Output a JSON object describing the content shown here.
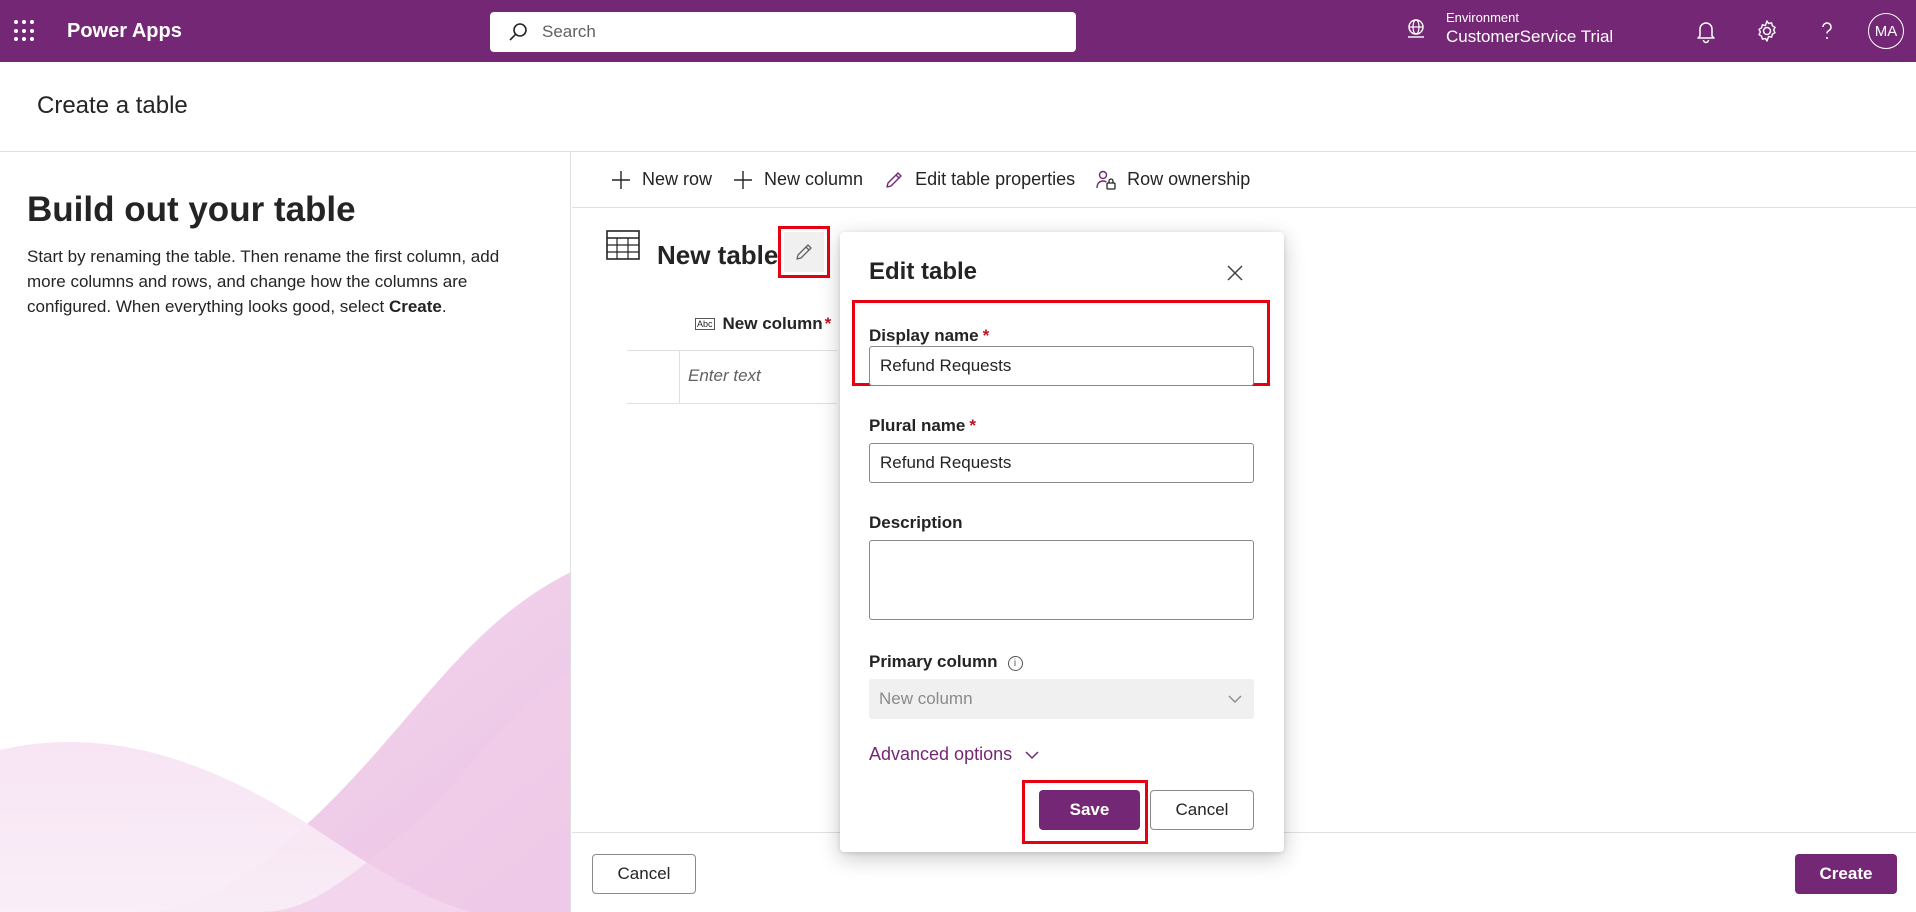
{
  "topbar": {
    "app_name": "Power Apps",
    "search_placeholder": "Search",
    "environment_label": "Environment",
    "environment_name": "CustomerService Trial",
    "avatar_initials": "MA",
    "icons": [
      "waffle-icon",
      "search-icon",
      "environment-icon",
      "bell-icon",
      "gear-icon",
      "help-icon"
    ]
  },
  "page": {
    "title": "Create a table"
  },
  "left_panel": {
    "heading": "Build out your table",
    "description_main": "Start by renaming the table. Then rename the first column, add more columns and rows, and change how the columns are configured. When everything looks good, select ",
    "description_bold": "Create",
    "description_end": "."
  },
  "command_bar": {
    "items": [
      {
        "label": "New row",
        "icon": "plus-icon"
      },
      {
        "label": "New column",
        "icon": "plus-icon"
      },
      {
        "label": "Edit table properties",
        "icon": "pencil-icon"
      },
      {
        "label": "Row ownership",
        "icon": "person-lock-icon"
      }
    ]
  },
  "table": {
    "name": "New table",
    "column_header": "New column",
    "column_required": "*",
    "column_type_icon": "Abc",
    "cell_placeholder": "Enter text"
  },
  "dialog": {
    "title": "Edit table",
    "display_name_label": "Display name",
    "display_name_value": "Refund Requests",
    "plural_name_label": "Plural name",
    "plural_name_value": "Refund Requests",
    "description_label": "Description",
    "description_value": "",
    "primary_column_label": "Primary column",
    "primary_column_value": "New column",
    "advanced_options": "Advanced options",
    "required_mark": "*",
    "save_label": "Save",
    "cancel_label": "Cancel"
  },
  "footer": {
    "cancel_label": "Cancel",
    "create_label": "Create"
  },
  "colors": {
    "brand": "#742774",
    "highlight": "#e60012",
    "required": "#c50f1f"
  }
}
